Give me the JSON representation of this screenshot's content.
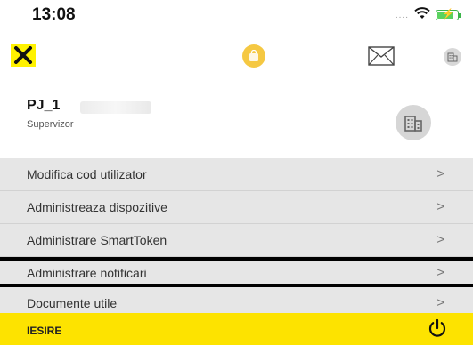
{
  "status_bar": {
    "time": "13:08",
    "signal": "....",
    "wifi_icon": "wifi-icon",
    "battery_icon": "battery-charging-icon",
    "battery_color": "#3bb54a"
  },
  "top_bar": {
    "logo_icon": "raiffeisen-logo-icon",
    "logo_color": "#fff200",
    "center_icon": "shopping-bag-icon",
    "mail_icon": "envelope-icon",
    "company_icon": "building-icon"
  },
  "profile": {
    "company_name": "PJ_1",
    "role": "Supervizor",
    "avatar_icon": "building-icon"
  },
  "menu": {
    "items": [
      {
        "label": "Modifica cod utilizator",
        "chevron": ">"
      },
      {
        "label": "Administreaza dispozitive",
        "chevron": ">"
      },
      {
        "label": "Administrare SmartToken",
        "chevron": ">"
      },
      {
        "label": "Administrare notificari",
        "chevron": ">"
      },
      {
        "label": "Documente utile",
        "chevron": ">"
      }
    ]
  },
  "exit": {
    "label": "IESIRE",
    "icon": "power-icon",
    "background": "#fde300"
  }
}
